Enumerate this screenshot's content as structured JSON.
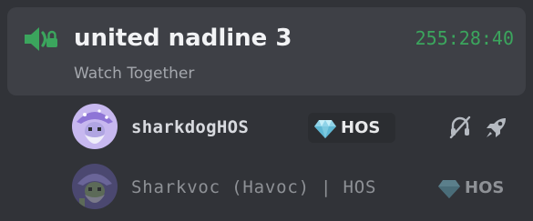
{
  "channel": {
    "name": "united nadline 3",
    "timer": "255:28:40",
    "activity": "Watch Together",
    "icon": "voice-activity-icon"
  },
  "members": [
    {
      "name": "sharkdogHOS",
      "tag": "HOS",
      "tag_icon": "gem-icon",
      "avatar": "wizard-avatar",
      "status_icons": [
        "deafened-icon",
        "rocket-icon"
      ]
    },
    {
      "name": "Sharkvoc (Havoc) | HOS",
      "tag": "HOS",
      "tag_icon": "gem-icon",
      "avatar": "wizard-avatar"
    }
  ],
  "colors": {
    "background": "#313338",
    "card": "#3e4046",
    "accent_green": "#3ba55d",
    "timer_green": "#3ba55d"
  }
}
